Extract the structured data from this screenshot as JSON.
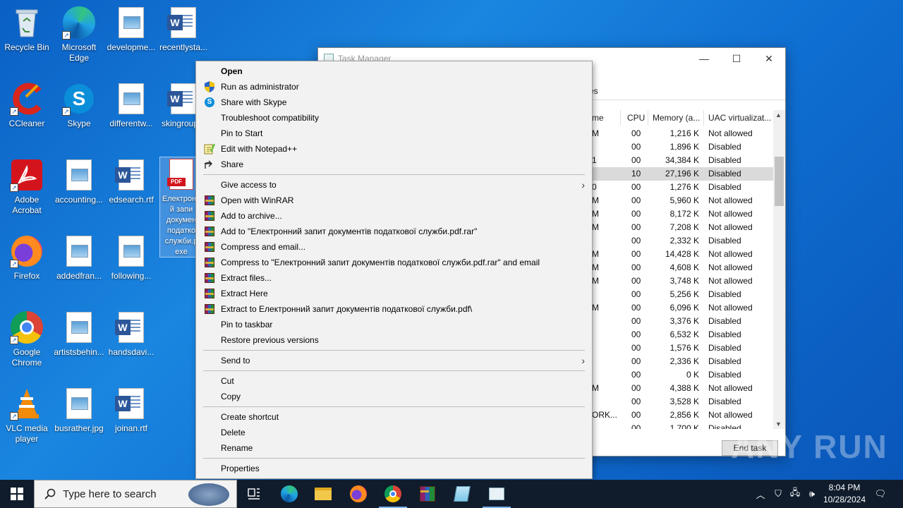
{
  "desktop": {
    "icons": [
      {
        "label": "Recycle Bin",
        "icon": "recycle-bin-icon"
      },
      {
        "label": "Microsoft Edge",
        "icon": "edge-icon"
      },
      {
        "label": "developme...",
        "icon": "image-file-icon"
      },
      {
        "label": "recentlysta...",
        "icon": "word-document-icon"
      },
      {
        "label": "CCleaner",
        "icon": "ccleaner-icon"
      },
      {
        "label": "Skype",
        "icon": "skype-icon"
      },
      {
        "label": "differentw...",
        "icon": "image-file-icon"
      },
      {
        "label": "skingroup...",
        "icon": "word-document-icon"
      },
      {
        "label": "Adobe Acrobat",
        "icon": "acrobat-icon"
      },
      {
        "label": "accounting...",
        "icon": "image-file-icon"
      },
      {
        "label": "edsearch.rtf",
        "icon": "word-document-icon"
      },
      {
        "label": "Електронний запит документів податкової служби.pdf.exe",
        "short": "Електронн й запи докумен податко служби.p exe",
        "icon": "pdf-exe-icon"
      },
      {
        "label": "Firefox",
        "icon": "firefox-icon"
      },
      {
        "label": "addedfran...",
        "icon": "image-file-icon"
      },
      {
        "label": "following...",
        "icon": "image-file-icon"
      },
      {
        "label": "Google Chrome",
        "icon": "chrome-icon"
      },
      {
        "label": "artistsbehin...",
        "icon": "image-file-icon"
      },
      {
        "label": "handsdavi...",
        "icon": "word-document-icon"
      },
      {
        "label": "VLC media player",
        "icon": "vlc-icon"
      },
      {
        "label": "busrather.jpg",
        "icon": "image-file-icon"
      },
      {
        "label": "joinan.rtf",
        "icon": "word-document-icon"
      }
    ]
  },
  "task_manager": {
    "title": "Task Manager",
    "tab_fragment": "es",
    "columns": {
      "name": "me",
      "cpu": "CPU",
      "memory": "Memory (a...",
      "uac": "UAC virtualizat..."
    },
    "rows": [
      {
        "name": "M",
        "cpu": "00",
        "mem": "1,216 K",
        "uac": "Not allowed"
      },
      {
        "name": "",
        "cpu": "00",
        "mem": "1,896 K",
        "uac": "Disabled"
      },
      {
        "name": "1",
        "cpu": "00",
        "mem": "34,384 K",
        "uac": "Disabled"
      },
      {
        "name": "",
        "cpu": "10",
        "mem": "27,196 K",
        "uac": "Disabled"
      },
      {
        "name": "0",
        "cpu": "00",
        "mem": "1,276 K",
        "uac": "Disabled"
      },
      {
        "name": "M",
        "cpu": "00",
        "mem": "5,960 K",
        "uac": "Not allowed"
      },
      {
        "name": "M",
        "cpu": "00",
        "mem": "8,172 K",
        "uac": "Not allowed"
      },
      {
        "name": "M",
        "cpu": "00",
        "mem": "7,208 K",
        "uac": "Not allowed"
      },
      {
        "name": "",
        "cpu": "00",
        "mem": "2,332 K",
        "uac": "Disabled"
      },
      {
        "name": "M",
        "cpu": "00",
        "mem": "14,428 K",
        "uac": "Not allowed"
      },
      {
        "name": "M",
        "cpu": "00",
        "mem": "4,608 K",
        "uac": "Not allowed"
      },
      {
        "name": "M",
        "cpu": "00",
        "mem": "3,748 K",
        "uac": "Not allowed"
      },
      {
        "name": "",
        "cpu": "00",
        "mem": "5,256 K",
        "uac": "Disabled"
      },
      {
        "name": "M",
        "cpu": "00",
        "mem": "6,096 K",
        "uac": "Not allowed"
      },
      {
        "name": "",
        "cpu": "00",
        "mem": "3,376 K",
        "uac": "Disabled"
      },
      {
        "name": "",
        "cpu": "00",
        "mem": "6,532 K",
        "uac": "Disabled"
      },
      {
        "name": "",
        "cpu": "00",
        "mem": "1,576 K",
        "uac": "Disabled"
      },
      {
        "name": "",
        "cpu": "00",
        "mem": "2,336 K",
        "uac": "Disabled"
      },
      {
        "name": "",
        "cpu": "00",
        "mem": "0 K",
        "uac": "Disabled"
      },
      {
        "name": "M",
        "cpu": "00",
        "mem": "4,388 K",
        "uac": "Not allowed"
      },
      {
        "name": "",
        "cpu": "00",
        "mem": "3,528 K",
        "uac": "Disabled"
      },
      {
        "name": "ORK...",
        "cpu": "00",
        "mem": "2,856 K",
        "uac": "Not allowed"
      },
      {
        "name": "",
        "cpu": "00",
        "mem": "1,700 K",
        "uac": "Disabled"
      }
    ],
    "end_task_label": "End task"
  },
  "context_menu": {
    "items": [
      {
        "label": "Open",
        "icon": "",
        "bold": true
      },
      {
        "label": "Run as administrator",
        "icon": "uac-shield-icon"
      },
      {
        "label": "Share with Skype",
        "icon": "skype-icon"
      },
      {
        "label": "Troubleshoot compatibility",
        "icon": ""
      },
      {
        "label": "Pin to Start",
        "icon": ""
      },
      {
        "label": "Edit with Notepad++",
        "icon": "notepadpp-icon"
      },
      {
        "label": "Share",
        "icon": "share-icon"
      },
      {
        "label": "Give access to",
        "icon": "",
        "submenu": true
      },
      {
        "label": "Open with WinRAR",
        "icon": "winrar-icon"
      },
      {
        "label": "Add to archive...",
        "icon": "winrar-icon"
      },
      {
        "label": "Add to \"Електронний запит документів податкової служби.pdf.rar\"",
        "icon": "winrar-icon"
      },
      {
        "label": "Compress and email...",
        "icon": "winrar-icon"
      },
      {
        "label": "Compress to \"Електронний запит документів податкової служби.pdf.rar\" and email",
        "icon": "winrar-icon"
      },
      {
        "label": "Extract files...",
        "icon": "winrar-icon"
      },
      {
        "label": "Extract Here",
        "icon": "winrar-icon"
      },
      {
        "label": "Extract to Електронний запит документів податкової служби.pdf\\",
        "icon": "winrar-icon"
      },
      {
        "label": "Pin to taskbar",
        "icon": ""
      },
      {
        "label": "Restore previous versions",
        "icon": ""
      },
      {
        "label": "Send to",
        "icon": "",
        "submenu": true
      },
      {
        "label": "Cut",
        "icon": ""
      },
      {
        "label": "Copy",
        "icon": ""
      },
      {
        "label": "Create shortcut",
        "icon": ""
      },
      {
        "label": "Delete",
        "icon": ""
      },
      {
        "label": "Rename",
        "icon": ""
      },
      {
        "label": "Properties",
        "icon": ""
      }
    ]
  },
  "taskbar": {
    "search_placeholder": "Type here to search",
    "apps": [
      "task-view-icon",
      "edge-icon",
      "file-explorer-icon",
      "firefox-icon",
      "chrome-icon",
      "winrar-icon",
      "notepad-icon",
      "task-manager-icon"
    ],
    "time": "8:04 PM",
    "date": "10/28/2024"
  },
  "watermark": "ANY RUN"
}
